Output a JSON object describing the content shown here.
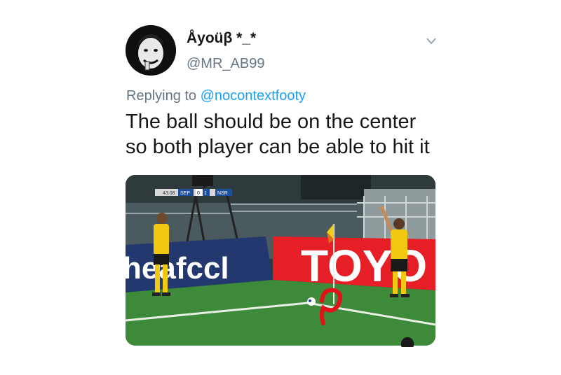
{
  "tweet": {
    "display_name": "Åyoüβ *_*",
    "handle": "@MR_AB99",
    "reply_prefix": "Replying to",
    "reply_mention": "@nocontextfooty",
    "text_line1": "The ball should be on the center",
    "text_line2": "so both player can be able to hit it",
    "avatar_icon": "profile-photo",
    "more_icon": "chevron-down-icon"
  },
  "media": {
    "scoreboard": {
      "time": "43:08",
      "home": "SEP",
      "home_score": "0",
      "away_score": "1",
      "away": "NSR"
    },
    "ad_board_left": "the-afc.com",
    "ad_board_left_visible": "heafccl",
    "ad_board_right": "TOYO",
    "annotation": "red circle around ball at corner flag"
  },
  "colors": {
    "mention": "#1da1f2",
    "secondary_text": "#657786",
    "primary_text": "#14171a",
    "jersey_yellow": "#f3c813",
    "annotation_red": "#e4101a"
  }
}
